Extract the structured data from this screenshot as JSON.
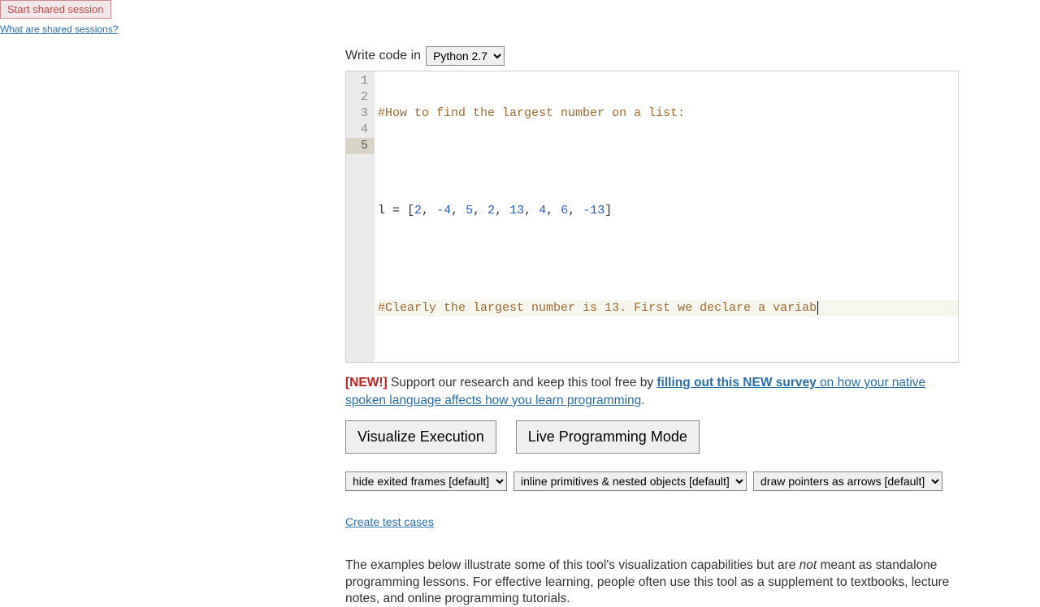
{
  "topbar": {
    "start_btn": "Start shared session",
    "what_link": "What are shared sessions?"
  },
  "write_label": "Write code in",
  "language_selector": "Python 2.7",
  "code_lines": {
    "l1": "#How to find the largest number on a list:",
    "l3_pre": "l = [",
    "l3_nums": [
      "2",
      "-4",
      "5",
      "2",
      "13",
      "4",
      "6",
      "-13"
    ],
    "l3_post": "]",
    "l5": "#Clearly the largest number is 13. First we declare a variab"
  },
  "survey": {
    "new": "[NEW!]",
    "pre": " Support our research and keep this tool free by ",
    "link": "filling out this NEW survey",
    "post1": " on how your native spoken language affects how you learn programming",
    "post2": "."
  },
  "buttons": {
    "visualize": "Visualize Execution",
    "live": "Live Programming Mode"
  },
  "options": {
    "frames": "hide exited frames [default]",
    "primitives": "inline primitives & nested objects [default]",
    "pointers": "draw pointers as arrows [default]"
  },
  "create_tests": "Create test cases",
  "examples_text": {
    "pre": "The examples below illustrate some of this tool's visualization capabilities but are ",
    "not": "not",
    "post": " meant as standalone programming lessons. For effective learning, people often use this tool as a supplement to textbooks, lecture notes, and online programming tutorials."
  }
}
